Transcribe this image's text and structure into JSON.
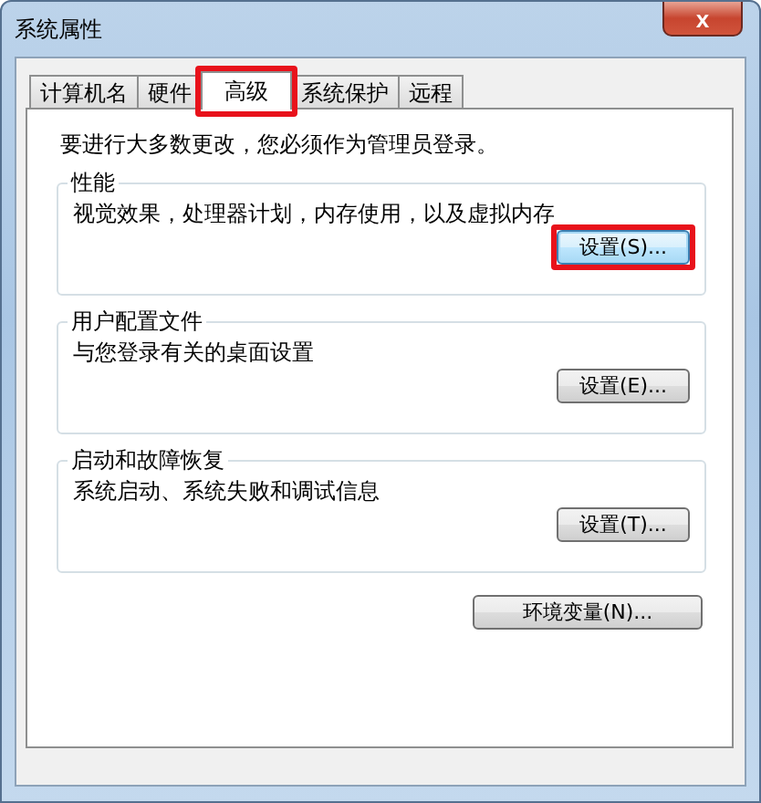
{
  "window": {
    "title": "系统属性",
    "close_label": "x"
  },
  "tabs": [
    {
      "label": "计算机名",
      "selected": false,
      "highlighted": false
    },
    {
      "label": "硬件",
      "selected": false,
      "highlighted": false
    },
    {
      "label": "高级",
      "selected": true,
      "highlighted": true
    },
    {
      "label": "系统保护",
      "selected": false,
      "highlighted": false
    },
    {
      "label": "远程",
      "selected": false,
      "highlighted": false
    }
  ],
  "notice": "要进行大多数更改，您必须作为管理员登录。",
  "groups": [
    {
      "title": "性能",
      "description": "视觉效果，处理器计划，内存使用，以及虚拟内存",
      "button": {
        "label": "设置(S)...",
        "focused": true,
        "highlighted": true
      }
    },
    {
      "title": "用户配置文件",
      "description": "与您登录有关的桌面设置",
      "button": {
        "label": "设置(E)...",
        "focused": false,
        "highlighted": false
      }
    },
    {
      "title": "启动和故障恢复",
      "description": "系统启动、系统失败和调试信息",
      "button": {
        "label": "设置(T)...",
        "focused": false,
        "highlighted": false
      }
    }
  ],
  "env_button": {
    "label": "环境变量(N)...",
    "focused": false,
    "highlighted": false
  }
}
